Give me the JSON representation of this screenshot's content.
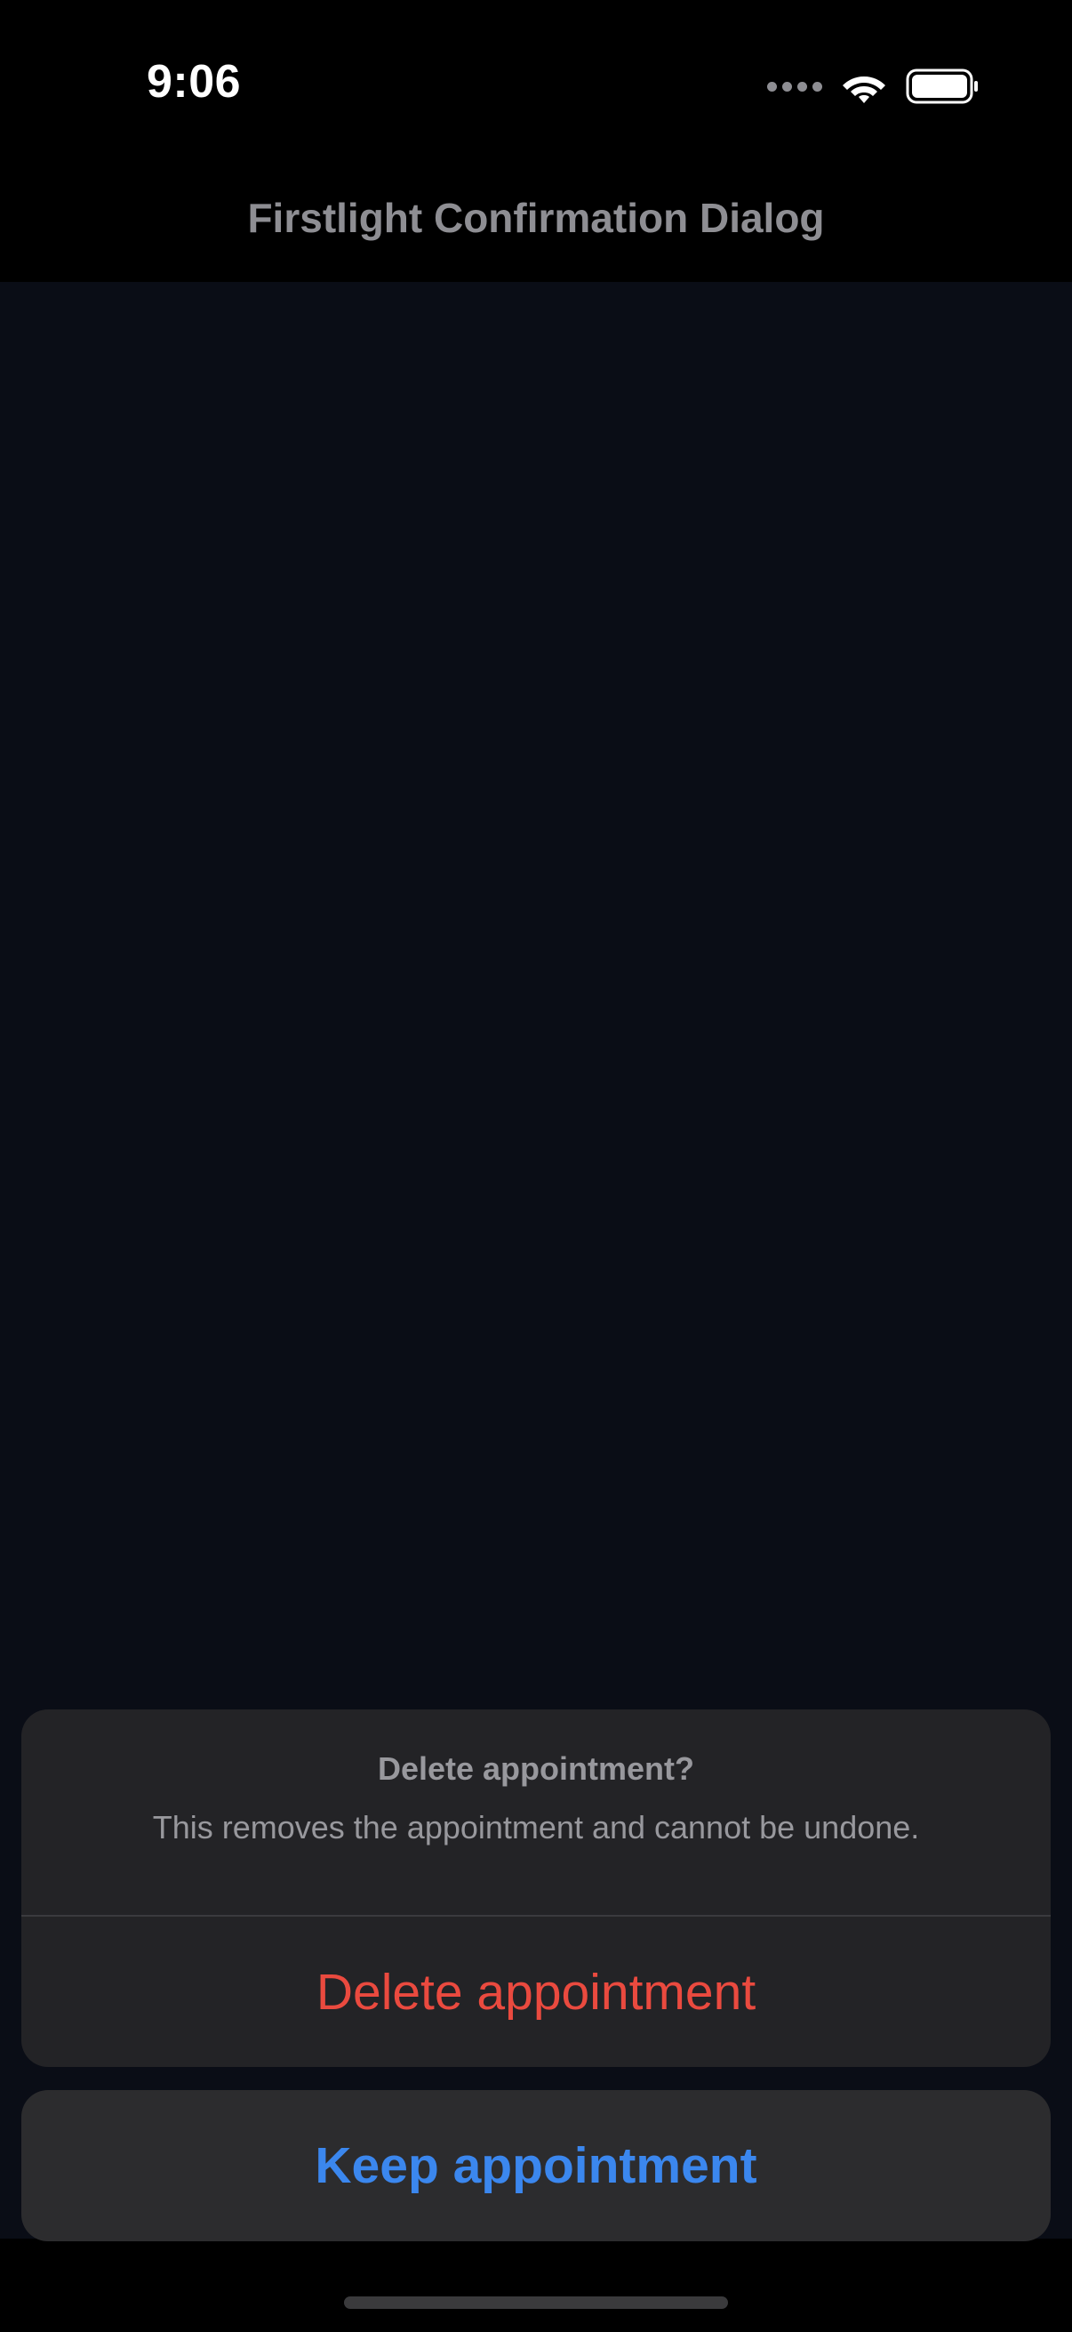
{
  "status_bar": {
    "time": "9:06",
    "icons": [
      "cellular-signal-icon",
      "wifi-icon",
      "battery-icon"
    ]
  },
  "navigation": {
    "title": "Firstlight Confirmation Dialog"
  },
  "confirmation_dialog": {
    "title": "Delete appointment?",
    "message": "This removes the appointment and cannot be undone.",
    "destructive_action_label": "Delete appointment",
    "cancel_action_label": "Keep appointment"
  },
  "colors": {
    "background": "#0a0d16",
    "sheet": "#232326",
    "destructive": "#ea4a3f",
    "accent": "#3b87ee",
    "secondary_text": "#98989d"
  }
}
